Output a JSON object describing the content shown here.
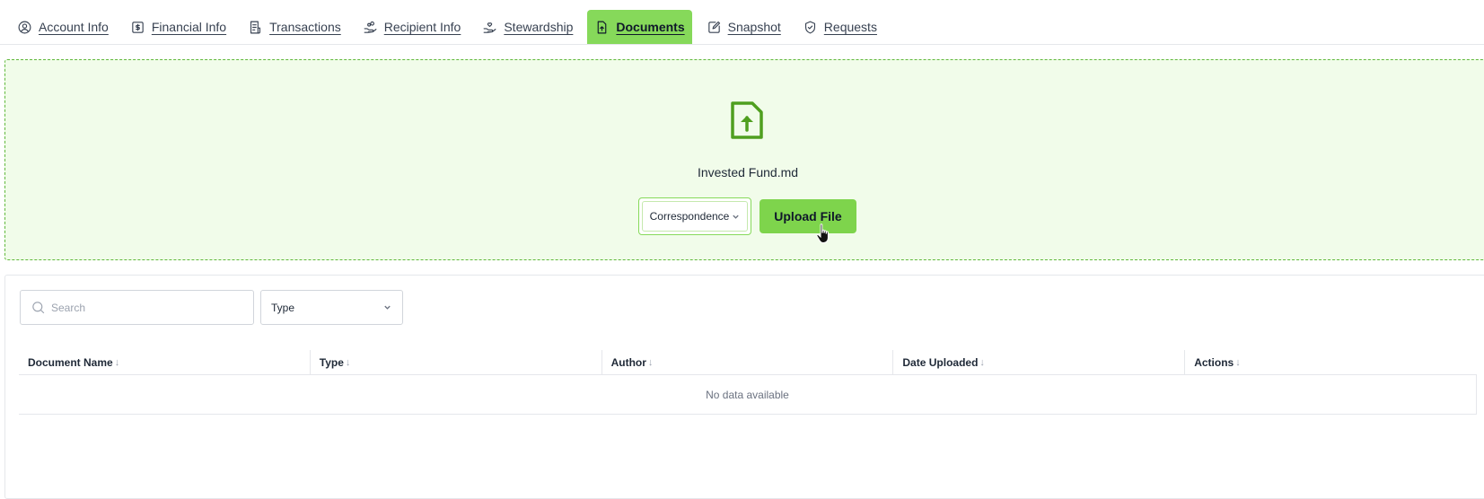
{
  "tabs": [
    {
      "label": "Account Info",
      "icon": "user-circle-icon",
      "active": false
    },
    {
      "label": "Financial Info",
      "icon": "dollar-square-icon",
      "active": false
    },
    {
      "label": "Transactions",
      "icon": "receipt-icon",
      "active": false
    },
    {
      "label": "Recipient Info",
      "icon": "hand-coins-icon",
      "active": false
    },
    {
      "label": "Stewardship",
      "icon": "hand-heart-icon",
      "active": false
    },
    {
      "label": "Documents",
      "icon": "file-upload-icon",
      "active": true
    },
    {
      "label": "Snapshot",
      "icon": "note-edit-icon",
      "active": false
    },
    {
      "label": "Requests",
      "icon": "shield-check-icon",
      "active": false
    }
  ],
  "upload": {
    "file_name": "Invested Fund.md",
    "document_type": "Correspondence",
    "button_label": "Upload File",
    "accent_color": "#7ed44c"
  },
  "filters": {
    "search_placeholder": "Search",
    "type_label": "Type"
  },
  "table": {
    "columns": [
      "Document Name",
      "Type",
      "Author",
      "Date Uploaded",
      "Actions"
    ],
    "sort_glyph": "↓",
    "empty_message": "No data available"
  }
}
